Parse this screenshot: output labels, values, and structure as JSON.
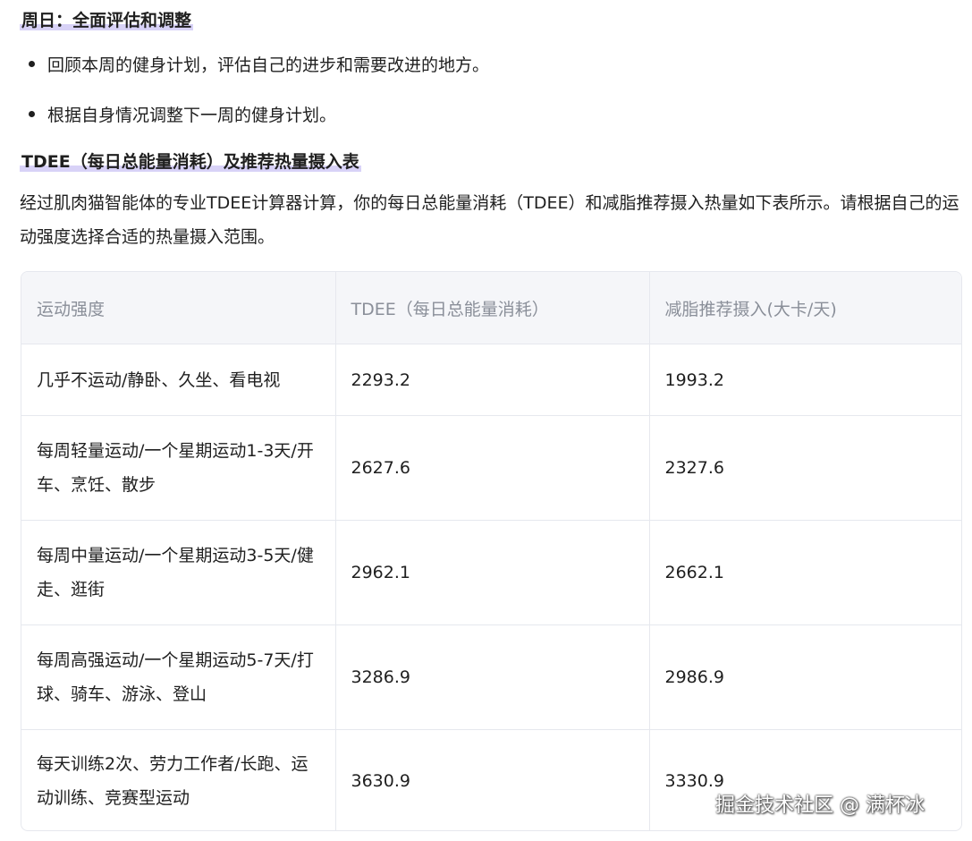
{
  "sunday_heading": "周日：全面评估和调整",
  "bullets": [
    "回顾本周的健身计划，评估自己的进步和需要改进的地方。",
    "根据自身情况调整下一周的健身计划。"
  ],
  "tdee_heading": "TDEE（每日总能量消耗）及推荐热量摄入表",
  "intro": "经过肌肉猫智能体的专业TDEE计算器计算，你的每日总能量消耗（TDEE）和减脂推荐摄入热量如下表所示。请根据自己的运动强度选择合适的热量摄入范围。",
  "table": {
    "headers": [
      "运动强度",
      "TDEE（每日总能量消耗）",
      "减脂推荐摄入(大卡/天)"
    ],
    "rows": [
      [
        "几乎不运动/静卧、久坐、看电视",
        "2293.2",
        "1993.2"
      ],
      [
        "每周轻量运动/一个星期运动1-3天/开车、烹饪、散步",
        "2627.6",
        "2327.6"
      ],
      [
        "每周中量运动/一个星期运动3-5天/健走、逛街",
        "2962.1",
        "2662.1"
      ],
      [
        "每周高强运动/一个星期运动5-7天/打球、骑车、游泳、登山",
        "3286.9",
        "2986.9"
      ],
      [
        "每天训练2次、劳力工作者/长跑、运动训练、竞赛型运动",
        "3630.9",
        "3330.9"
      ]
    ]
  },
  "watermark": "掘金技术社区 @ 满杯冰"
}
